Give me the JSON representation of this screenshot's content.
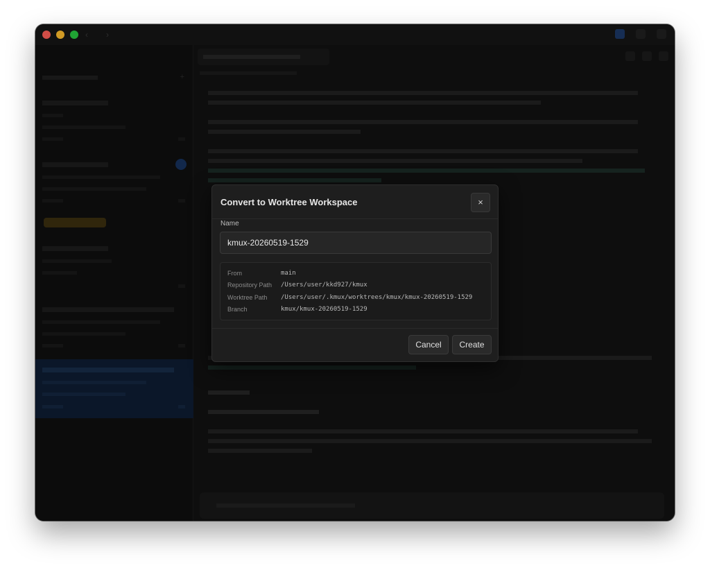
{
  "dialog": {
    "title": "Convert to Worktree Workspace",
    "close_glyph": "×",
    "name_label": "Name",
    "name_value": "kmux-20260519-1529",
    "info": [
      {
        "label": "From",
        "value": "main"
      },
      {
        "label": "Repository Path",
        "value": "/Users/user/kkd927/kmux"
      },
      {
        "label": "Worktree Path",
        "value": "/Users/user/.kmux/worktrees/kmux/kmux-20260519-1529"
      },
      {
        "label": "Branch",
        "value": "kmux/kmux-20260519-1529"
      }
    ],
    "cancel_label": "Cancel",
    "create_label": "Create"
  },
  "icons": {
    "close": "close-icon"
  }
}
